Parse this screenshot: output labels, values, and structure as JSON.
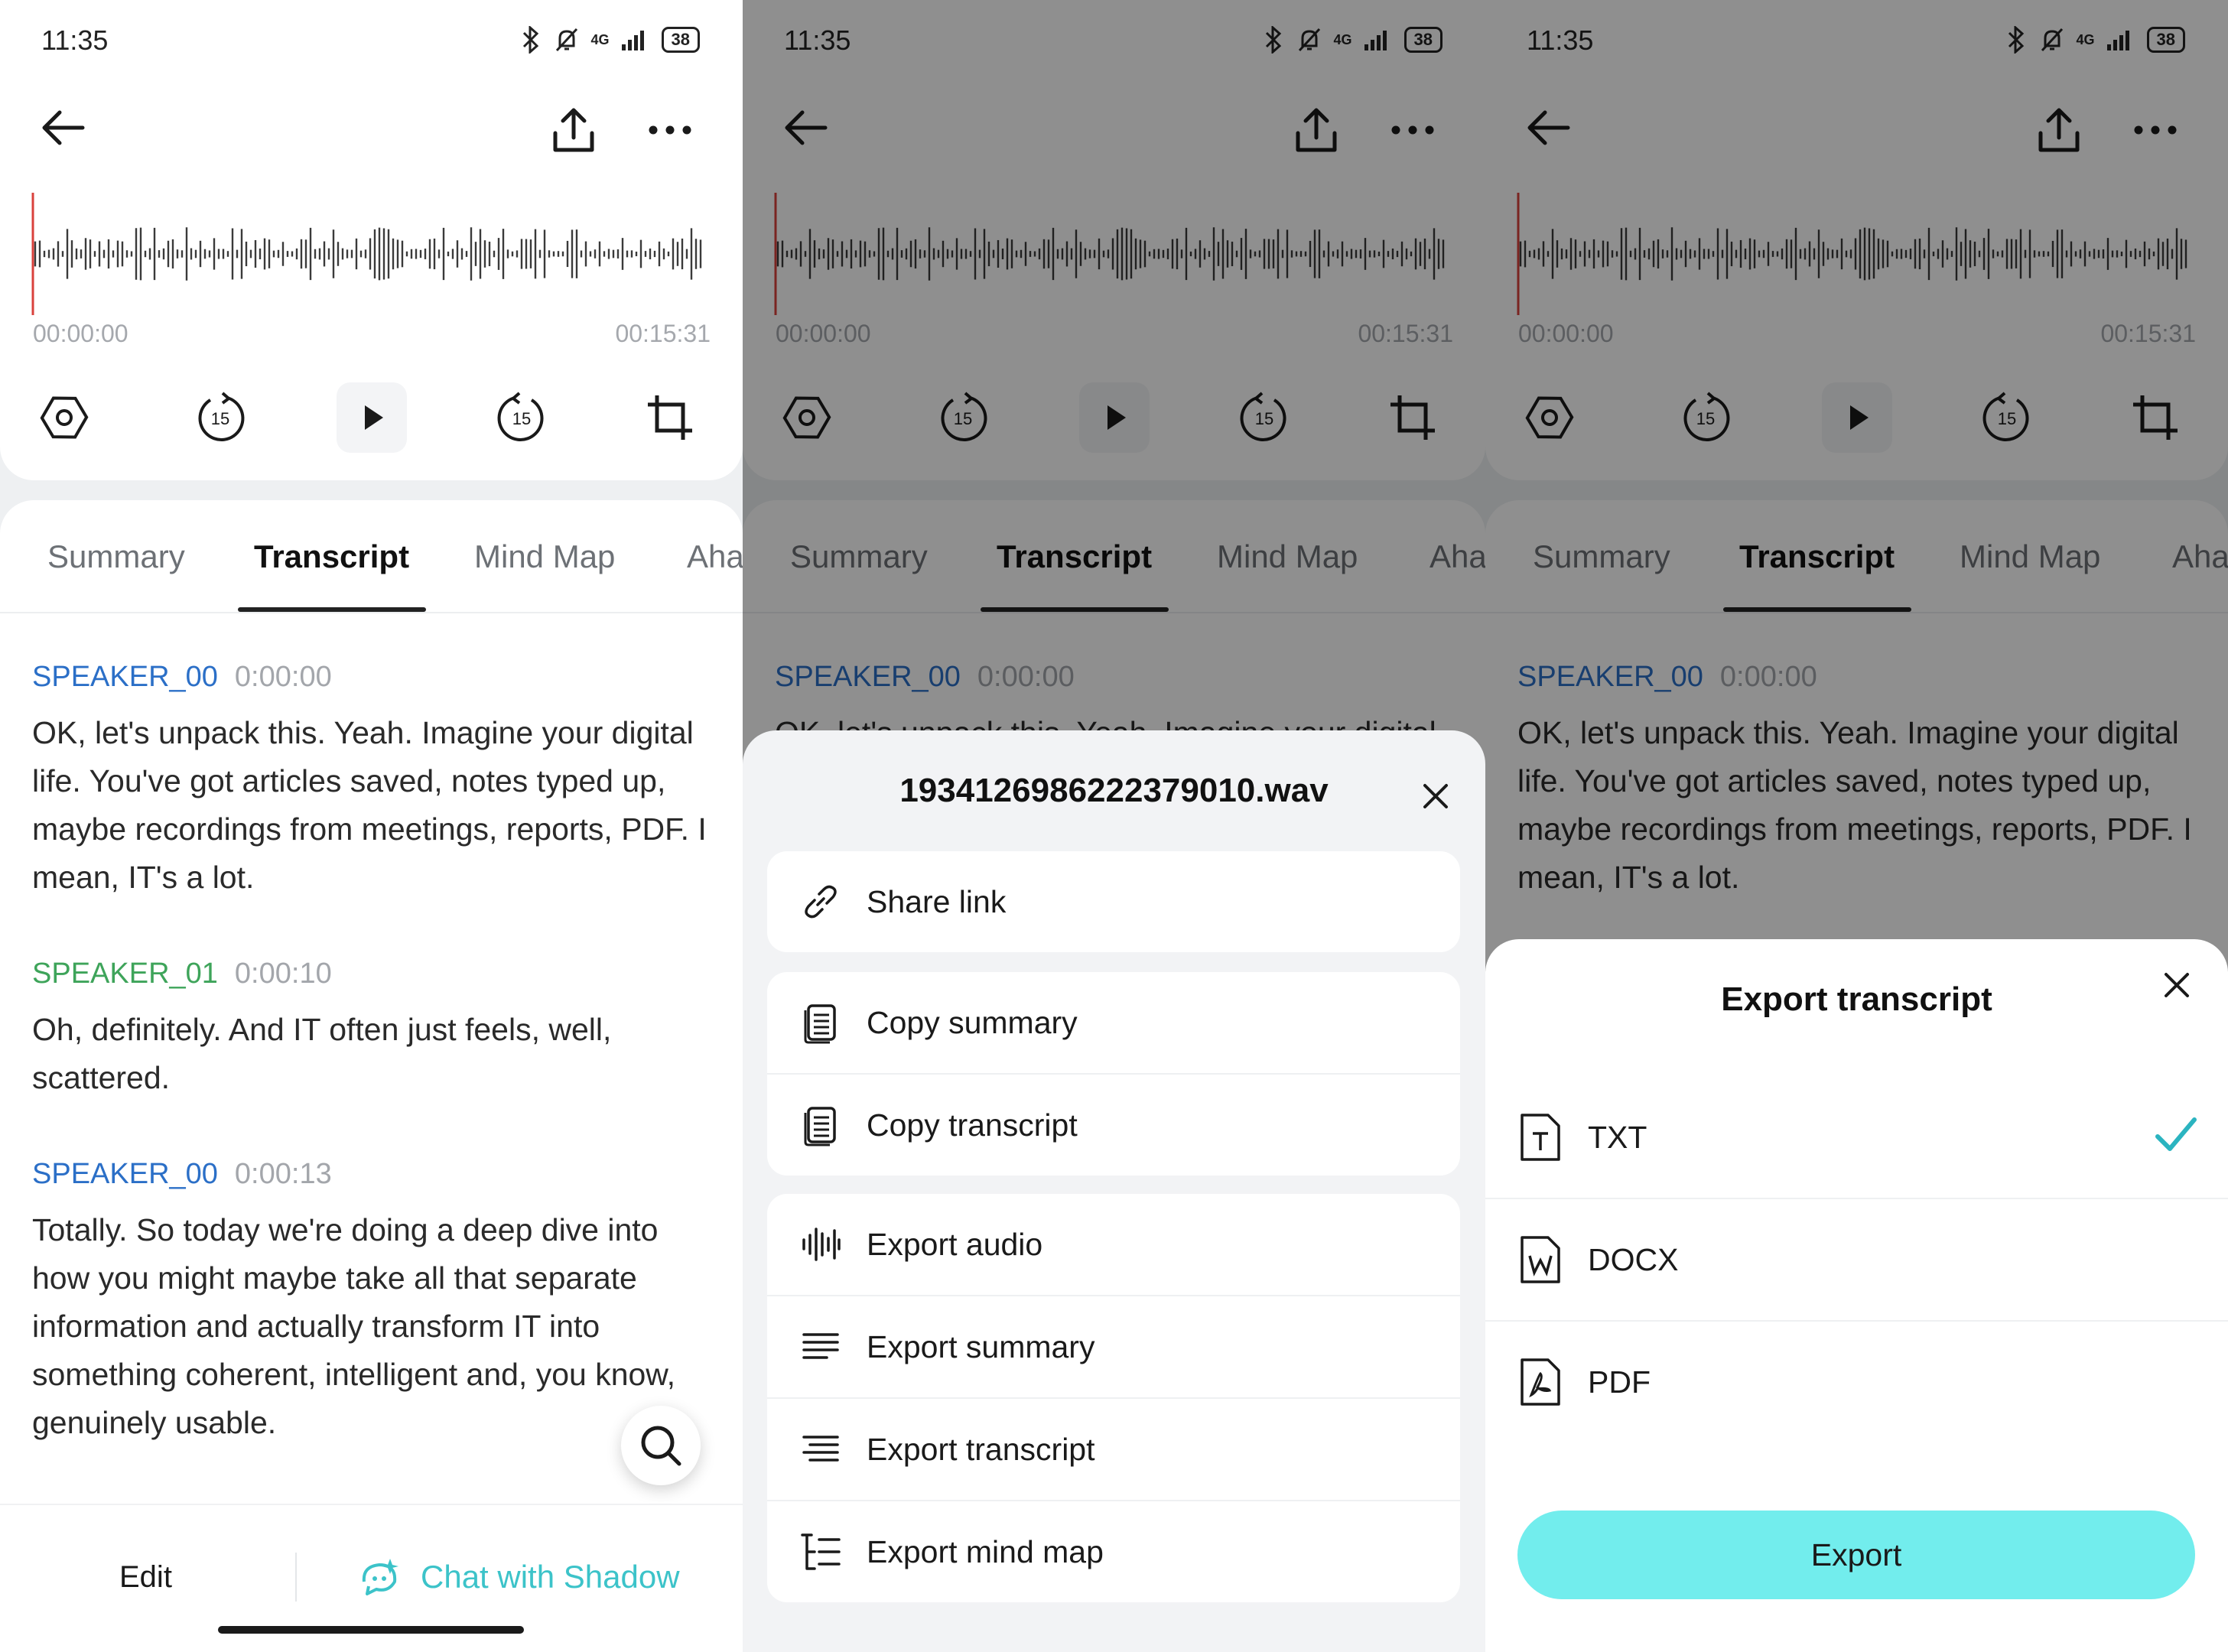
{
  "status": {
    "time": "11:35",
    "network": "4G",
    "battery": "38"
  },
  "player": {
    "time_start": "00:00:00",
    "time_end": "00:15:31",
    "skip_back": "15",
    "skip_forward": "15"
  },
  "tabs": [
    "Summary",
    "Transcript",
    "Mind Map",
    "Aha"
  ],
  "transcript": [
    {
      "speaker": "SPEAKER_00",
      "time": "0:00:00",
      "text": "OK, let's unpack this. Yeah. Imagine your digital life. You've got articles saved, notes typed up, maybe recordings from meetings, reports, PDF. I mean, IT's a lot."
    },
    {
      "speaker": "SPEAKER_01",
      "time": "0:00:10",
      "text": "Oh, definitely. And IT often just feels, well, scattered."
    },
    {
      "speaker": "SPEAKER_00",
      "time": "0:00:13",
      "text": "Totally. So today we're doing a deep dive into how you might maybe take all that separate information and actually transform IT into something coherent, intelligent and, you know, genuinely usable."
    }
  ],
  "bottom": {
    "edit": "Edit",
    "chat": "Chat with Shadow"
  },
  "share_sheet": {
    "title": "1934126986222379010.wav",
    "groups": [
      [
        "Share link"
      ],
      [
        "Copy summary",
        "Copy transcript"
      ],
      [
        "Export audio",
        "Export summary",
        "Export transcript",
        "Export mind map"
      ]
    ]
  },
  "export_sheet": {
    "title": "Export transcript",
    "formats": [
      "TXT",
      "DOCX",
      "PDF"
    ],
    "selected": "TXT",
    "button": "Export",
    "accent": "#72eded"
  },
  "colors": {
    "speaker_00": "#2b6fc7",
    "speaker_01": "#3ea45a",
    "chat": "#3cc3c9",
    "playhead": "#d9413c"
  }
}
